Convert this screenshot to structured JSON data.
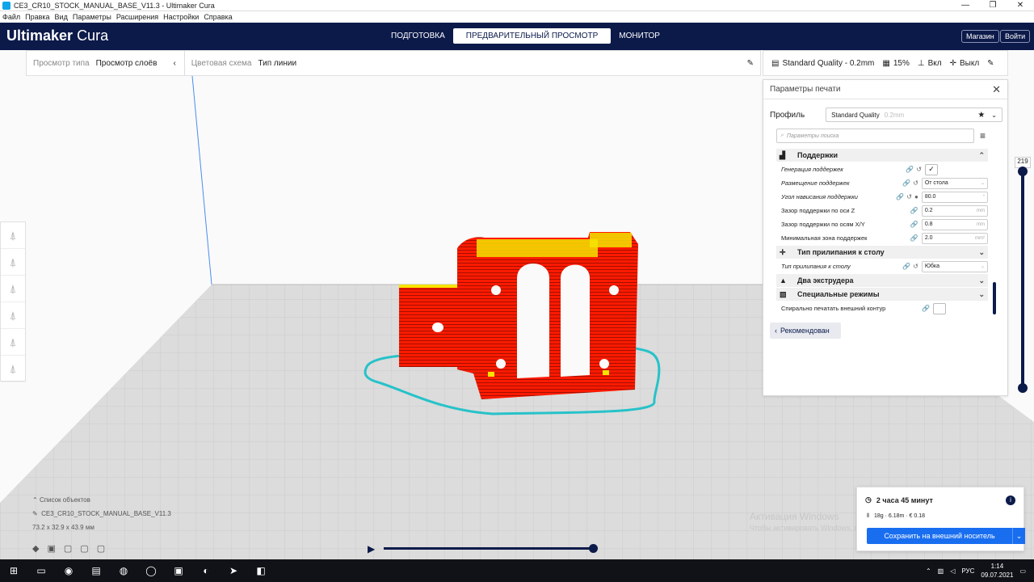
{
  "window": {
    "title": "CE3_CR10_STOCK_MANUAL_BASE_V11.3 - Ultimaker Cura"
  },
  "menu": [
    "Файл",
    "Правка",
    "Вид",
    "Параметры",
    "Расширения",
    "Настройки",
    "Справка"
  ],
  "header": {
    "logo_brand": "Ultimaker",
    "logo_product": "Cura",
    "tabs": [
      "ПОДГОТОВКА",
      "ПРЕДВАРИТЕЛЬНЫЙ ПРОСМОТР",
      "МОНИТОР"
    ],
    "active_tab": 1,
    "marketplace": "Магазин",
    "signin": "Войти"
  },
  "viewbar": {
    "view_type_label": "Просмотр типа",
    "view_type_value": "Просмотр слоёв",
    "color_scheme_label": "Цветовая схема",
    "color_scheme_value": "Тип линии"
  },
  "printbar": {
    "profile": "Standard Quality - 0.2mm",
    "infill": "15%",
    "support": "Вкл",
    "adhesion": "Выкл"
  },
  "panel": {
    "title": "Параметры печати",
    "profile_label": "Профиль",
    "profile_value": "Standard Quality",
    "profile_sub": "0.2mm",
    "search_placeholder": "Параметры поиска",
    "categories": {
      "support": "Поддержки",
      "adhesion": "Тип прилипания к столу",
      "dual": "Два экструдера",
      "special": "Специальные режимы"
    },
    "rows": {
      "gen_support": {
        "name": "Генерация поддержек",
        "checked": true
      },
      "placement": {
        "name": "Размещение поддержек",
        "value": "От стола"
      },
      "angle": {
        "name": "Угол нависания поддержки",
        "value": "80.0",
        "unit": "°"
      },
      "z_dist": {
        "name": "Зазор поддержки по оси Z",
        "value": "0.2",
        "unit": "mm"
      },
      "xy_dist": {
        "name": "Зазор поддержки по осям X/Y",
        "value": "0.8",
        "unit": "mm"
      },
      "min_area": {
        "name": "Минимальная зона поддержек",
        "value": "2.0",
        "unit": "mm²"
      },
      "adhesion_type": {
        "name": "Тип прилипания к столу",
        "value": "Юбка"
      },
      "spiral": {
        "name": "Спирально печатать внешний контур",
        "checked": false
      }
    },
    "recommended": "Рекомендован"
  },
  "layer_slider": {
    "top_value": "219"
  },
  "objects": {
    "list_label": "Список объектов",
    "name": "CE3_CR10_STOCK_MANUAL_BASE_V11.3",
    "dims": "73.2 x 32.9 x 43.9 мм"
  },
  "watermark": {
    "title": "Активация Windows",
    "subtitle": "Чтобы активировать Windows, перейдите в раздел \"Параметры\"."
  },
  "output": {
    "time": "2 часа 45 минут",
    "material": "18g · 6.18m · € 0.18",
    "save": "Сохранить на внешний носитель"
  },
  "taskbar": {
    "lang": "РУС",
    "time": "1:14",
    "date": "09.07.2021"
  },
  "colors": {
    "header": "#0c1a4a",
    "accent": "#196ef0",
    "model_red": "#ff1a00",
    "model_yellow": "#f5e400",
    "skirt": "#27c2c9"
  }
}
